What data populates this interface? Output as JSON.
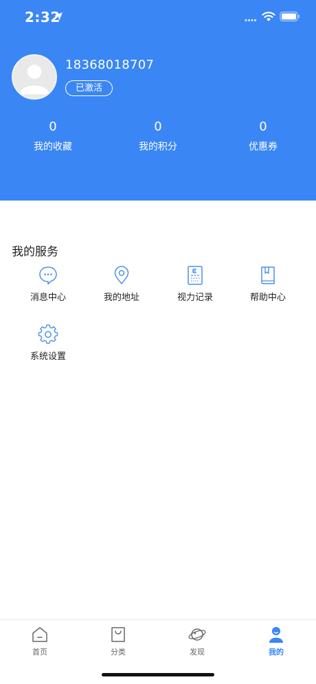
{
  "status_bar": {
    "time": "2:32"
  },
  "profile": {
    "phone": "18368018707",
    "badge": "已激活"
  },
  "stats": [
    {
      "value": "0",
      "label": "我的收藏"
    },
    {
      "value": "0",
      "label": "我的积分"
    },
    {
      "value": "0",
      "label": "优惠券"
    }
  ],
  "services": {
    "title": "我的服务",
    "items": [
      {
        "label": "消息中心",
        "icon": "message-icon"
      },
      {
        "label": "我的地址",
        "icon": "location-pin-icon"
      },
      {
        "label": "视力记录",
        "icon": "eye-chart-icon"
      },
      {
        "label": "帮助中心",
        "icon": "book-icon"
      },
      {
        "label": "系统设置",
        "icon": "gear-icon"
      }
    ]
  },
  "tabbar": {
    "items": [
      {
        "label": "首页",
        "icon": "home-icon"
      },
      {
        "label": "分类",
        "icon": "bag-icon"
      },
      {
        "label": "发现",
        "icon": "planet-icon"
      },
      {
        "label": "我的",
        "icon": "user-icon",
        "active": true
      }
    ]
  },
  "colors": {
    "primary": "#3a86f5",
    "icon_blue": "#4a8fe8",
    "text": "#222222"
  }
}
